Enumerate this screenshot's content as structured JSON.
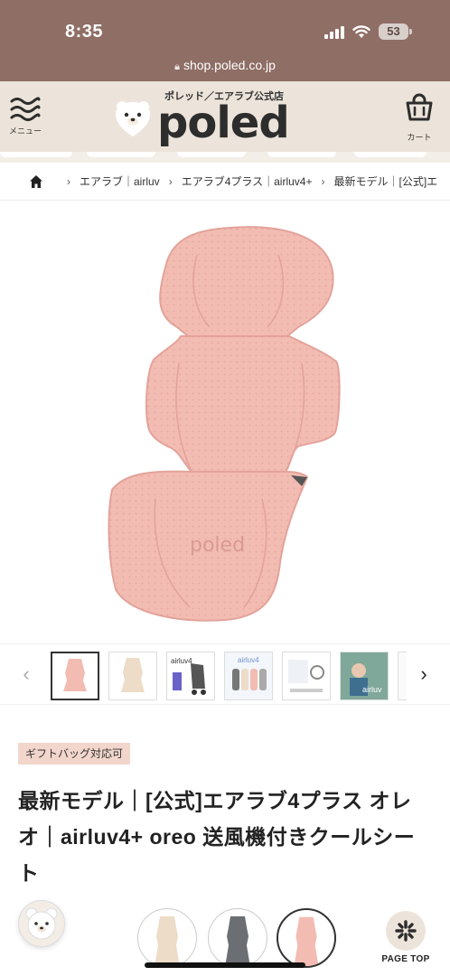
{
  "status_bar": {
    "time": "8:35",
    "battery": "53"
  },
  "browser": {
    "url": "shop.poled.co.jp"
  },
  "header": {
    "menu_label": "メニュー",
    "logo_tagline": "ポレッド／エアラブ公式店",
    "logo_text": "poled",
    "cart_label": "カート"
  },
  "breadcrumb": {
    "items": [
      "エアラブ｜airluv",
      "エアラブ4プラス｜airluv4+",
      "最新モデル｜[公式]エ"
    ]
  },
  "product": {
    "image_brand_mark": "poled",
    "gift_badge": "ギフトバッグ対応可",
    "title": "最新モデル｜[公式]エアラブ4プラス オレオ｜airluv4+ oreo 送風機付きクールシート",
    "thumbnail_text": [
      "airluv4",
      "airluv4",
      "airluv"
    ]
  },
  "bottom": {
    "page_top_label": "PAGE TOP"
  },
  "colors": {
    "chrome": "#8f6e65",
    "header_bg": "#ece4da",
    "seat_pink": "#f0b7ae",
    "badge_bg": "#f2d6cc"
  }
}
